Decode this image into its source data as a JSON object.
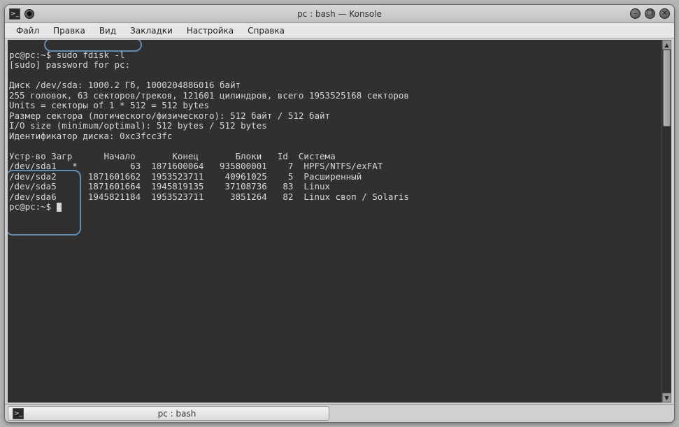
{
  "window": {
    "title": "pc : bash — Konsole"
  },
  "menu": {
    "file": "Файл",
    "edit": "Правка",
    "view": "Вид",
    "bookmarks": "Закладки",
    "settings": "Настройка",
    "help": "Справка"
  },
  "term": {
    "prompt1_user": "pc@pc:~",
    "prompt1_sep": "$ ",
    "cmd": "sudo fdisk -l",
    "sudo_line": "[sudo] password for pc:",
    "disk_line": "Диск /dev/sda: 1000.2 Гб, 1000204886016 байт",
    "heads_line": "255 головок, 63 секторов/треков, 121601 цилиндров, всего 1953525168 секторов",
    "units_line": "Units = секторы of 1 * 512 = 512 bytes",
    "sector_line": "Размер сектора (логического/физического): 512 байт / 512 байт",
    "io_line": "I/O size (minimum/optimal): 512 bytes / 512 bytes",
    "ident_line": "Идентификатор диска: 0xc3fcc3fc",
    "header": "Устр-во Загр      Начало       Конец       Блоки   Id  Система",
    "row1": "/dev/sda1   *          63  1871600064   935800001    7  HPFS/NTFS/exFAT",
    "row2": "/dev/sda2      1871601662  1953523711    40961025    5  Расширенный",
    "row3": "/dev/sda5      1871601664  1945819135    37108736   83  Linux",
    "row4": "/dev/sda6      1945821184  1953523711     3851264   82  Linux своп / Solaris",
    "prompt2": "pc@pc:~$ "
  },
  "tab": {
    "title": "pc : bash"
  }
}
